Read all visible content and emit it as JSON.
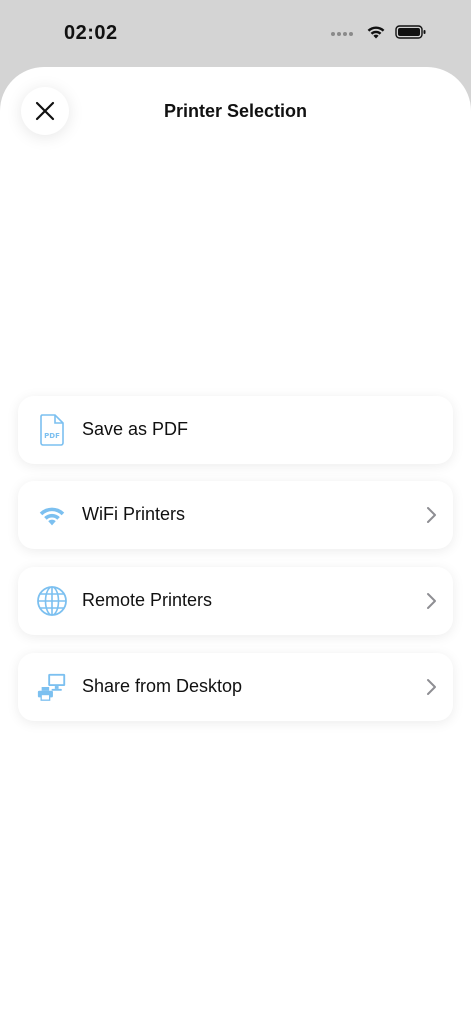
{
  "status_bar": {
    "time": "02:02",
    "icons": [
      "cellular-dots-icon",
      "wifi-icon",
      "battery-icon"
    ]
  },
  "sheet": {
    "title": "Printer Selection",
    "close_icon": "close-icon"
  },
  "options": [
    {
      "label": "Save as PDF",
      "icon": "pdf-file-icon",
      "chevron": false
    },
    {
      "label": "WiFi Printers",
      "icon": "wifi-icon",
      "chevron": true
    },
    {
      "label": "Remote Printers",
      "icon": "globe-icon",
      "chevron": true
    },
    {
      "label": "Share from Desktop",
      "icon": "desktop-printer-icon",
      "chevron": true
    }
  ],
  "colors": {
    "accent": "#7cc0f0",
    "background_dim": "#d4d4d4",
    "sheet": "#ffffff",
    "chevron": "#8e8e93"
  }
}
